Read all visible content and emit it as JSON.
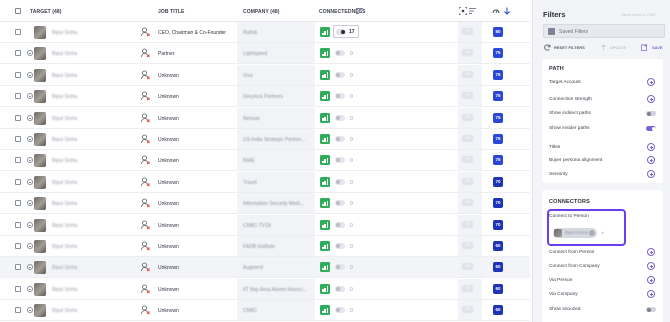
{
  "table": {
    "headers": {
      "target": "TARGET (48)",
      "job_title": "JOB TITLE",
      "company": "COMPANY (48)",
      "connectedness": "CONNECTEDNESS"
    },
    "rows": [
      {
        "name": "Bipul Sinha",
        "job_title": "CEO, Chairman & Co-Founder",
        "company": "Rubrik",
        "count": "17",
        "tag": "+60",
        "score": "80"
      },
      {
        "name": "Bipul Sinha",
        "job_title": "Partner",
        "company": "Lightspeed",
        "count": "0",
        "tag": "+60",
        "score": "75"
      },
      {
        "name": "Bipul Sinha",
        "job_title": "Unknown",
        "company": "Viva",
        "count": "0",
        "tag": "+60",
        "score": "75"
      },
      {
        "name": "Bipul Sinha",
        "job_title": "Unknown",
        "company": "Greylock Partners",
        "count": "0",
        "tag": "+60",
        "score": "75"
      },
      {
        "name": "Bipul Sinha",
        "job_title": "Unknown",
        "company": "Nexsan",
        "count": "0",
        "tag": "+60",
        "score": "75"
      },
      {
        "name": "Bipul Sinha",
        "job_title": "Unknown",
        "company": "US-India Strategic Partner...",
        "count": "0",
        "tag": "+60",
        "score": "75"
      },
      {
        "name": "Bipul Sinha",
        "job_title": "Unknown",
        "company": "NIAE",
        "count": "0",
        "tag": "+60",
        "score": "75"
      },
      {
        "name": "Bipul Sinha",
        "job_title": "Unknown",
        "company": "Travel",
        "count": "0",
        "tag": "+60",
        "score": "70"
      },
      {
        "name": "Bipul Sinha",
        "job_title": "Unknown",
        "company": "Information Security Medi...",
        "count": "0",
        "tag": "+60",
        "score": "70"
      },
      {
        "name": "Bipul Sinha",
        "job_title": "Unknown",
        "company": "CNBC-TV18",
        "count": "0",
        "tag": "+60",
        "score": "70"
      },
      {
        "name": "Bipul Sinha",
        "job_title": "Unknown",
        "company": "FADB Institute",
        "count": "0",
        "tag": "+60",
        "score": "60"
      },
      {
        "name": "Bipul Sinha",
        "job_title": "Unknown",
        "company": "Augment",
        "count": "0",
        "tag": "+60",
        "score": "60"
      },
      {
        "name": "Bipul Sinha",
        "job_title": "Unknown",
        "company": "IIT Bay Area Alumni Associ...",
        "count": "0",
        "tag": "+60",
        "score": "60"
      },
      {
        "name": "Bipul Sinha",
        "job_title": "Unknown",
        "company": "CNBC",
        "count": "0",
        "tag": "+60",
        "score": "60"
      }
    ]
  },
  "filters": {
    "title": "Filters",
    "subtitle": "Saved search in CRM",
    "saved_filters_label": "Saved Filters",
    "reset_label": "RESET FILTERS",
    "update_label": "UPDATE",
    "save_label": "SAVE",
    "path": {
      "title": "PATH",
      "target_account": "Target Account",
      "connection_strength": "Connection strength",
      "show_indirect_paths": "Show indirect paths",
      "show_insider_paths": "Show insider paths",
      "titles": "Titles",
      "buyer_persona": "Buyer persona alignment",
      "seniority": "Seniority"
    },
    "connectors": {
      "title": "CONNECTORS",
      "connect_to_person": "Connect to Person",
      "selected_person": "Bipul Sinha",
      "connect_from_person": "Connect from Person",
      "connect_from_company": "Connect from Company",
      "via_person": "Via Person",
      "via_company": "Via Company",
      "show_snoozed": "Show snoozed"
    }
  },
  "colors": {
    "accent": "#7d63d6",
    "highlight_border": "#6b3ff0",
    "score_blue": "#2a47d6",
    "strength_green": "#2eae5a"
  }
}
